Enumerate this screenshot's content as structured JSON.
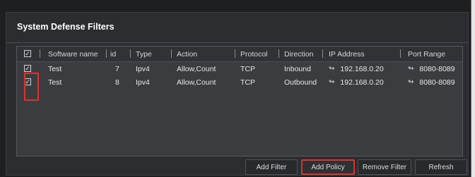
{
  "panel": {
    "title": "System Defense Filters"
  },
  "table": {
    "headers": [
      "Software name",
      "id",
      "Type",
      "Action",
      "Protocol",
      "Direction",
      "IP Address",
      "Port Range"
    ],
    "rows": [
      {
        "checked": true,
        "software_name": "Test",
        "id": "7",
        "type": "Ipv4",
        "action": "Allow,Count",
        "protocol": "TCP",
        "direction": "Inbound",
        "ip_address": "192.168.0.20",
        "port_range": "8080-8089"
      },
      {
        "checked": true,
        "software_name": "Test",
        "id": "8",
        "type": "Ipv4",
        "action": "Allow,Count",
        "protocol": "TCP",
        "direction": "Outbound",
        "ip_address": "192.168.0.20",
        "port_range": "8080-8089"
      }
    ],
    "icon": "ip-edit-icon",
    "check_mark": "✓"
  },
  "buttons": {
    "add_filter": "Add Filter",
    "add_policy": "Add Policy",
    "remove_filter": "Remove Filter",
    "refresh": "Refresh"
  },
  "colors": {
    "highlight": "#d9332e",
    "background": "#1d1f21",
    "panel": "#2b2d30",
    "table": "#3a3c40"
  }
}
